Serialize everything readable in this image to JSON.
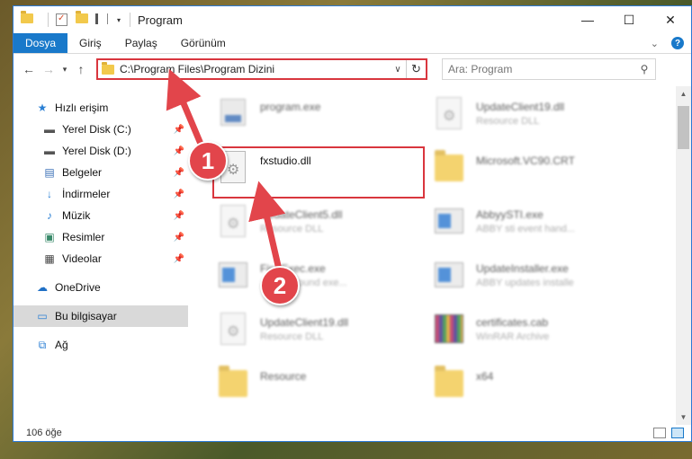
{
  "window": {
    "title": "Program",
    "controls": {
      "minimize": "—",
      "maximize": "☐",
      "close": "✕"
    }
  },
  "ribbon": {
    "tabs": [
      "Dosya",
      "Giriş",
      "Paylaş",
      "Görünüm"
    ],
    "active_tab": "Dosya"
  },
  "nav": {
    "address": "C:\\Program Files\\Program Dizini",
    "search_placeholder": "Ara: Program"
  },
  "sidebar": {
    "items": [
      {
        "label": "Hızlı erişim",
        "icon": "star-icon",
        "pinned": false
      },
      {
        "label": "Yerel Disk (C:)",
        "icon": "drive-icon",
        "pinned": true
      },
      {
        "label": "Yerel Disk (D:)",
        "icon": "drive-icon",
        "pinned": true
      },
      {
        "label": "Belgeler",
        "icon": "documents-icon",
        "pinned": true
      },
      {
        "label": "İndirmeler",
        "icon": "download-icon",
        "pinned": true
      },
      {
        "label": "Müzik",
        "icon": "music-icon",
        "pinned": true
      },
      {
        "label": "Resimler",
        "icon": "pictures-icon",
        "pinned": true
      },
      {
        "label": "Videolar",
        "icon": "videos-icon",
        "pinned": true
      },
      {
        "label": "OneDrive",
        "icon": "cloud-icon",
        "pinned": false
      },
      {
        "label": "Bu bilgisayar",
        "icon": "computer-icon",
        "pinned": false,
        "selected": true
      },
      {
        "label": "Ağ",
        "icon": "network-icon",
        "pinned": false
      }
    ]
  },
  "files": [
    {
      "name": "program.exe",
      "sub": "",
      "icon": "program-icon"
    },
    {
      "name": "UpdateClient19.dll",
      "sub": "Resource DLL",
      "icon": "dll-icon"
    },
    {
      "name": "fxstudio.dll",
      "sub": "",
      "icon": "dll-icon"
    },
    {
      "name": "Microsoft.VC90.CRT",
      "sub": "",
      "icon": "folder-icon"
    },
    {
      "name": "UpdateClient5.dll",
      "sub": "Resource DLL",
      "icon": "dll-icon"
    },
    {
      "name": "AbbyySTI.exe",
      "sub": "ABBY sti event hand...",
      "icon": "exe-icon"
    },
    {
      "name": "FineExec.exe",
      "sub": "...background exe...",
      "icon": "exe-icon"
    },
    {
      "name": "UpdateInstaller.exe",
      "sub": "ABBY updates installe",
      "icon": "exe-icon"
    },
    {
      "name": "UpdateClient19.dll",
      "sub": "Resource DLL",
      "icon": "dll-icon"
    },
    {
      "name": "certificates.cab",
      "sub": "WinRAR Archive",
      "icon": "cab-icon"
    },
    {
      "name": "Resource",
      "sub": "",
      "icon": "folder-icon"
    },
    {
      "name": "x64",
      "sub": "",
      "icon": "folder-icon"
    }
  ],
  "status": {
    "item_count": "106 öğe"
  },
  "annotations": {
    "step1": "1",
    "step2": "2"
  },
  "colors": {
    "accent": "#1979ca",
    "highlight": "#d9363e",
    "badge": "#e2454b"
  }
}
